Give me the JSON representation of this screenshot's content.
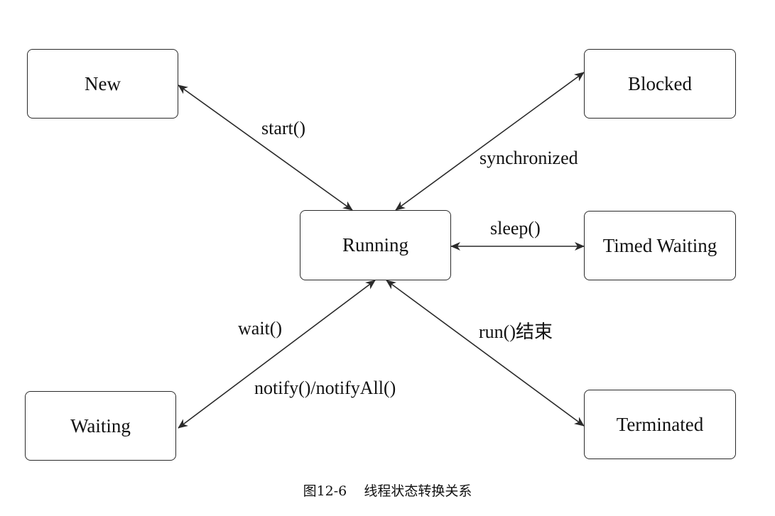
{
  "diagram": {
    "states": {
      "new": "New",
      "blocked": "Blocked",
      "running": "Running",
      "timed_waiting": "Timed Waiting",
      "waiting": "Waiting",
      "terminated": "Terminated"
    },
    "transitions": {
      "new_running": "start()",
      "running_blocked": "synchronized",
      "running_timed_waiting": "sleep()",
      "running_waiting_top": "wait()",
      "running_waiting_bottom": "notify()/notifyAll()",
      "running_terminated": "run()结束"
    },
    "colors": {
      "stroke": "#2a2a2a",
      "text": "#111111",
      "background": "#ffffff"
    }
  },
  "caption": {
    "figure_number": "图12-6",
    "title": "线程状态转换关系"
  }
}
